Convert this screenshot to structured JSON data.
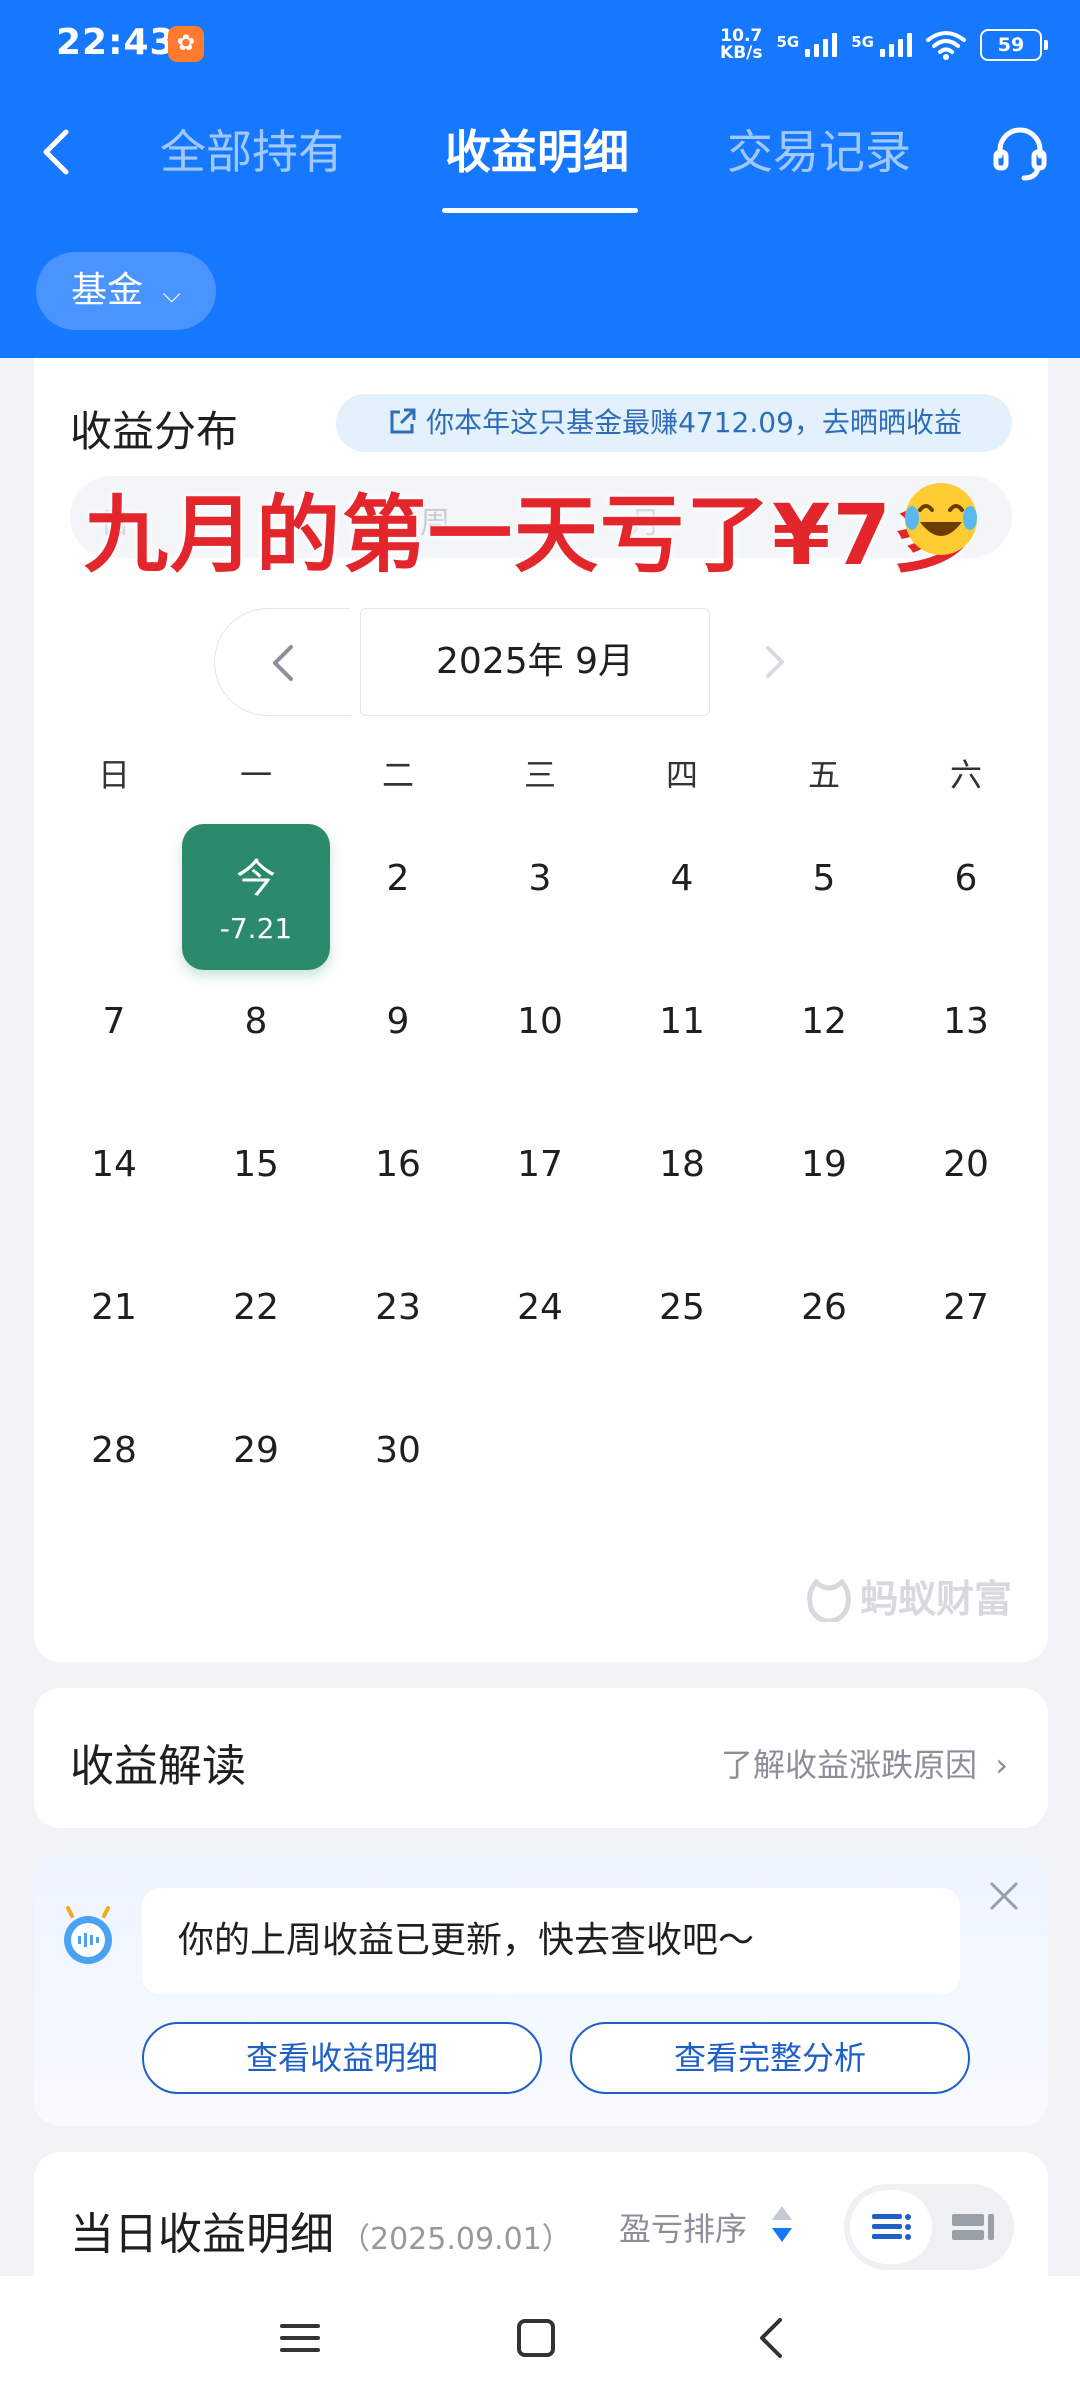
{
  "status_bar": {
    "time": "22:43",
    "net_speed_value": "10.7",
    "net_speed_unit": "KB/s",
    "sim1": "5G",
    "sim2": "5G",
    "battery": "59"
  },
  "nav": {
    "tabs": [
      {
        "label": "全部持有",
        "active": false
      },
      {
        "label": "收益明细",
        "active": true
      },
      {
        "label": "交易记录",
        "active": false
      }
    ]
  },
  "filter": {
    "label": "基金"
  },
  "distribution": {
    "title": "收益分布",
    "share_text": "你本年这只基金最赚4712.09，去晒晒收益",
    "overlay_text": "九月的第一天亏了¥7多",
    "month_label": "2025年 9月",
    "weekdays": [
      "日",
      "一",
      "二",
      "三",
      "四",
      "五",
      "六"
    ],
    "today_label": "今",
    "today_value": "-7.21",
    "days": [
      "2",
      "3",
      "4",
      "5",
      "6",
      "7",
      "8",
      "9",
      "10",
      "11",
      "12",
      "13",
      "14",
      "15",
      "16",
      "17",
      "18",
      "19",
      "20",
      "21",
      "22",
      "23",
      "24",
      "25",
      "26",
      "27",
      "28",
      "29",
      "30"
    ],
    "watermark": "蚂蚁财富"
  },
  "interpretation": {
    "title": "收益解读",
    "link": "了解收益涨跌原因"
  },
  "notice": {
    "message": "你的上周收益已更新，快去查收吧～",
    "btn_detail": "查看收益明细",
    "btn_analysis": "查看完整分析"
  },
  "daily": {
    "title": "当日收益明细",
    "date": "（2025.09.01）",
    "sort_label": "盈亏排序"
  },
  "colors": {
    "header_blue": "#1677ff",
    "today_green": "#2c8a6c",
    "overlay_red": "#e2262b"
  }
}
